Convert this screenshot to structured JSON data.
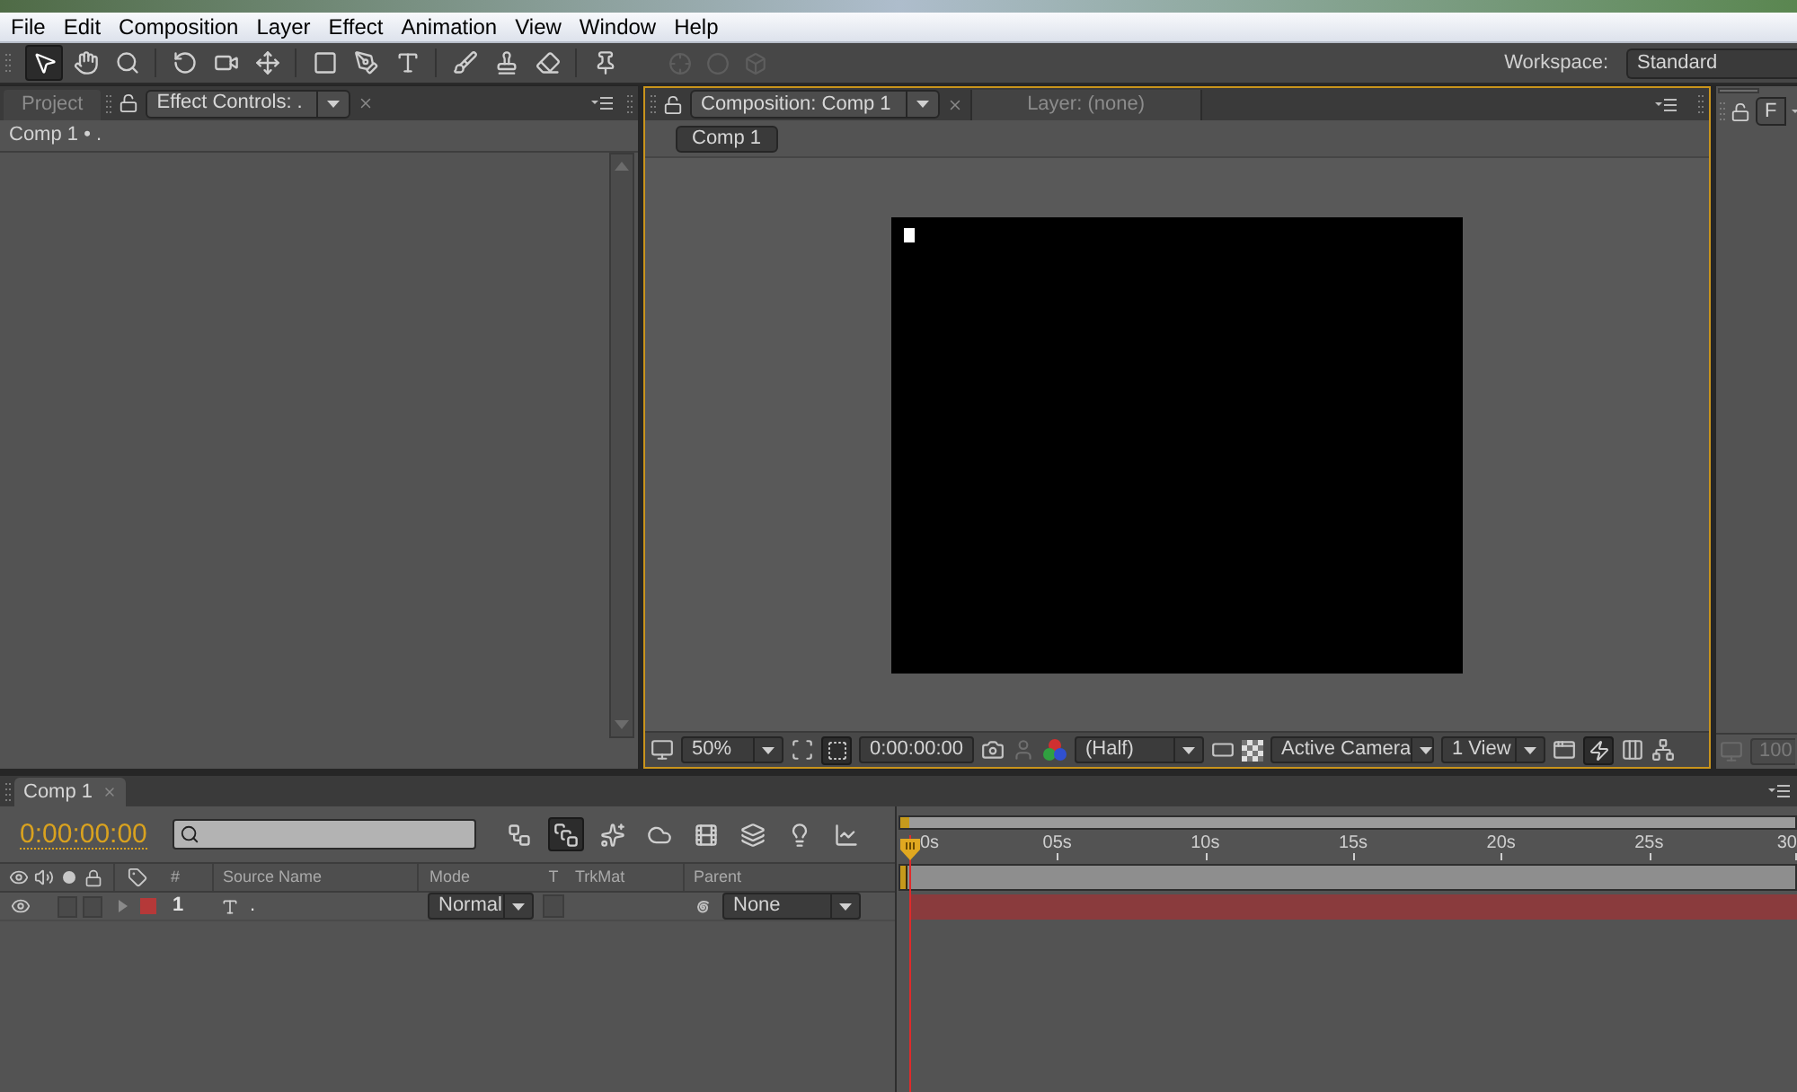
{
  "menu_bar": [
    "File",
    "Edit",
    "Composition",
    "Layer",
    "Effect",
    "Animation",
    "View",
    "Window",
    "Help"
  ],
  "toolbar": {
    "tools": [
      {
        "selected": true
      },
      {
        "selected": false
      },
      {
        "selected": false
      },
      {
        "selected": false
      },
      {
        "selected": false
      },
      {
        "selected": false
      },
      {
        "selected": false
      },
      {
        "selected": false
      },
      {
        "selected": false
      },
      {
        "selected": false
      },
      {
        "selected": false
      },
      {
        "selected": false
      },
      {
        "selected": false
      }
    ],
    "axis_modes": [
      {
        "disabled": true
      },
      {
        "disabled": true
      },
      {
        "disabled": true
      }
    ],
    "workspace": {
      "label": "Workspace:",
      "value": "Standard"
    }
  },
  "effect_panel": {
    "tabs": [
      {
        "label": "Project",
        "selected": false
      },
      {
        "label": "Effect Controls: .",
        "selected": true
      }
    ],
    "header": "Comp 1 • ."
  },
  "composition_panel": {
    "tabs": [
      {
        "label": "Composition: Comp 1",
        "selected": true
      },
      {
        "label": "Layer: (none)",
        "selected": false
      }
    ],
    "breadcrumb": "Comp 1",
    "footer": {
      "zoom": "50%",
      "mask_view_on": true,
      "timecode": "0:00:00:00",
      "resolution": "(Half)",
      "camera": "Active Camera",
      "layout": "1 View",
      "fast_previews_on": true
    }
  },
  "right_panel": {
    "tab": "F",
    "zoom": "100"
  },
  "timeline": {
    "tab": "Comp 1",
    "timecode": "0:00:00:00",
    "switches": [
      {
        "selected": false
      },
      {
        "selected": true
      },
      {
        "selected": false
      },
      {
        "selected": false
      },
      {
        "selected": false
      },
      {
        "selected": false
      },
      {
        "selected": false
      },
      {
        "selected": false
      }
    ],
    "ruler": [
      "0s",
      "05s",
      "10s",
      "15s",
      "20s",
      "25s",
      "30"
    ],
    "columns": [
      "#",
      "Source Name",
      "Mode",
      "T",
      "TrkMat",
      "Parent"
    ],
    "layers": [
      {
        "number": "1",
        "name": ".",
        "color": "#b53939",
        "visible": true,
        "solo": false,
        "locked": false,
        "expanded": false,
        "mode": "Normal",
        "preserve_transparency": false,
        "parent": "None"
      }
    ]
  }
}
